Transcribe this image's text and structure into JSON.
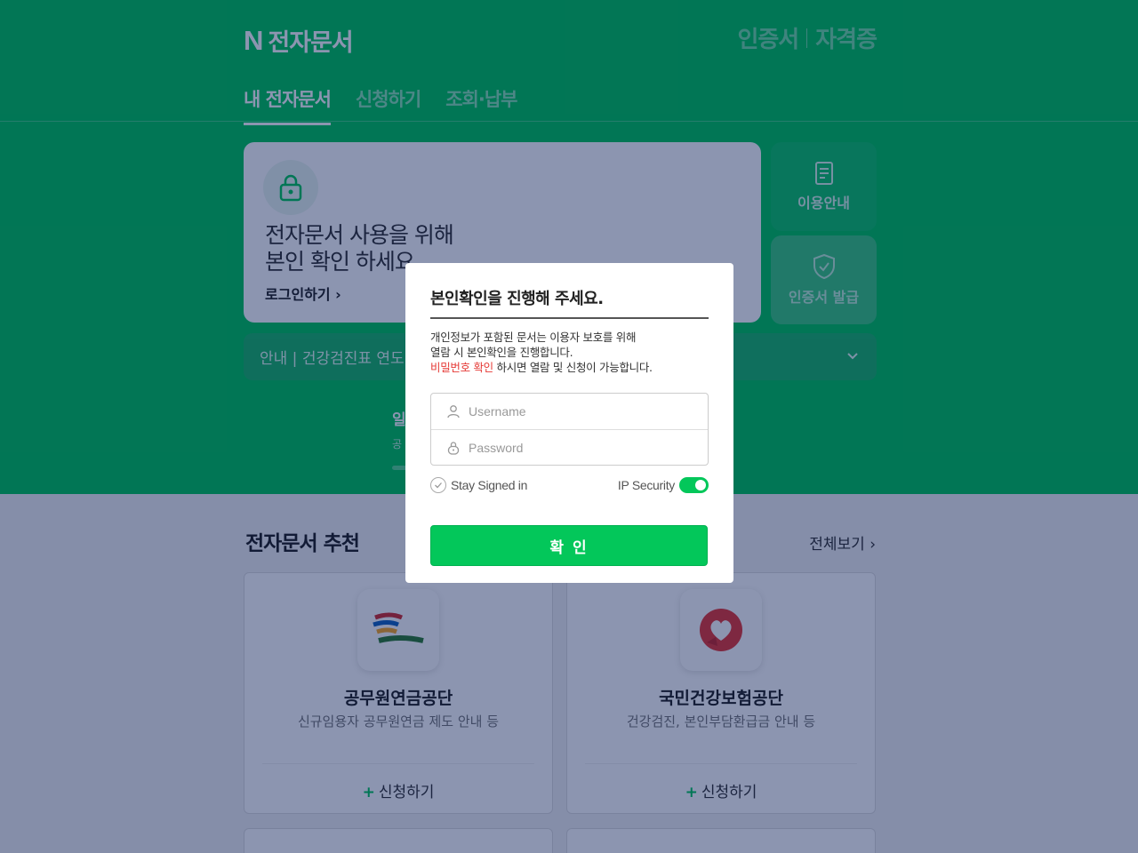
{
  "header": {
    "logo_mark": "N",
    "logo_text": "전자문서",
    "links": [
      "인증서",
      "자격증"
    ]
  },
  "tabs": [
    {
      "label": "내 전자문서",
      "active": true
    },
    {
      "label": "신청하기",
      "active": false
    },
    {
      "label": "조회·납부",
      "active": false
    }
  ],
  "hero": {
    "line1": "전자문서 사용을 위해",
    "line2": "본인 확인 하세요",
    "login_label": "로그인하기 ›"
  },
  "side_buttons": [
    "이용안내",
    "인증서 발급"
  ],
  "notice": {
    "text": "안내 | 건강검진표 연도"
  },
  "stats": {
    "title": "일",
    "sub": "공"
  },
  "recommend": {
    "title": "전자문서 추천",
    "view_all": "전체보기 ›",
    "cards": [
      {
        "name": "공무원연금공단",
        "desc": "신규임용자 공무원연금 제도 안내 등",
        "apply": "신청하기"
      },
      {
        "name": "국민건강보험공단",
        "desc": "건강검진, 본인부담환급금 안내 등",
        "apply": "신청하기"
      }
    ]
  },
  "modal": {
    "title": "본인확인을 진행해 주세요.",
    "desc_line1": "개인정보가 포함된 문서는 이용자 보호를 위해",
    "desc_line2": "열람 시 본인확인을 진행합니다.",
    "desc_red": "비밀번호 확인",
    "desc_line3_rest": " 하시면 열람 및 신청이 가능합니다.",
    "username_placeholder": "Username",
    "password_placeholder": "Password",
    "stay_signed_in": "Stay Signed in",
    "ip_security": "IP Security",
    "ip_security_on": true,
    "confirm_label": "확 인"
  },
  "colors": {
    "brand_green": "#03c75a",
    "overlay": "#00145073",
    "highlight_red": "#e53935"
  }
}
